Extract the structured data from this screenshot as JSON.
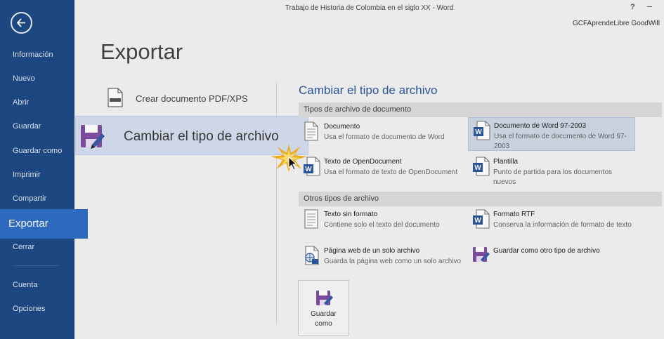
{
  "window": {
    "doc_title": "Trabajo de Historia de Colombia en el siglo XX - Word",
    "help_label": "?",
    "minimize_label": "–",
    "user_name": "GCFAprendeLibre GoodWill"
  },
  "sidebar": {
    "items": [
      {
        "label": "Información"
      },
      {
        "label": "Nuevo"
      },
      {
        "label": "Abrir"
      },
      {
        "label": "Guardar"
      },
      {
        "label": "Guardar como"
      },
      {
        "label": "Imprimir"
      },
      {
        "label": "Compartir"
      },
      {
        "label": "Exportar",
        "active": true
      },
      {
        "label": "Cerrar"
      },
      {
        "label": "Cuenta"
      },
      {
        "label": "Opciones"
      }
    ]
  },
  "main": {
    "page_title": "Exportar",
    "options": [
      {
        "label": "Crear documento PDF/XPS"
      },
      {
        "label": "Cambiar el tipo de archivo"
      }
    ],
    "section_title": "Cambiar el tipo de archivo",
    "groups": [
      {
        "header": "Tipos de archivo de documento",
        "types": [
          {
            "name": "Documento",
            "desc": "Usa el formato de documento de Word",
            "icon": "word-document-icon"
          },
          {
            "name": "Documento de Word 97-2003",
            "desc": "Usa el formato de documento de Word 97-2003",
            "icon": "word-97-document-icon",
            "selected": true
          },
          {
            "name": "Texto de OpenDocument",
            "desc": "Usa el formato de texto de OpenDocument",
            "icon": "opendocument-icon"
          },
          {
            "name": "Plantilla",
            "desc": "Punto de partida para los documentos nuevos",
            "icon": "template-icon"
          }
        ]
      },
      {
        "header": "Otros tipos de archivo",
        "types": [
          {
            "name": "Texto sin formato",
            "desc": "Contiene solo el texto del documento",
            "icon": "plain-text-icon"
          },
          {
            "name": "Formato RTF",
            "desc": "Conserva la información de formato de texto",
            "icon": "rtf-icon"
          },
          {
            "name": "Página web de un solo archivo",
            "desc": "Guarda la página web como un solo archivo",
            "icon": "web-page-icon"
          },
          {
            "name": "Guardar como otro tipo de archivo",
            "desc": "",
            "icon": "save-as-icon"
          }
        ]
      }
    ],
    "save_button": {
      "line1": "Guardar",
      "line2": "como"
    }
  },
  "colors": {
    "sidebar_bg": "#1d4a86",
    "sidebar_active": "#2f6ec4",
    "accent": "#2b579a",
    "callout_bg": "#d4def0",
    "save_icon_purple": "#7e4fa0"
  }
}
